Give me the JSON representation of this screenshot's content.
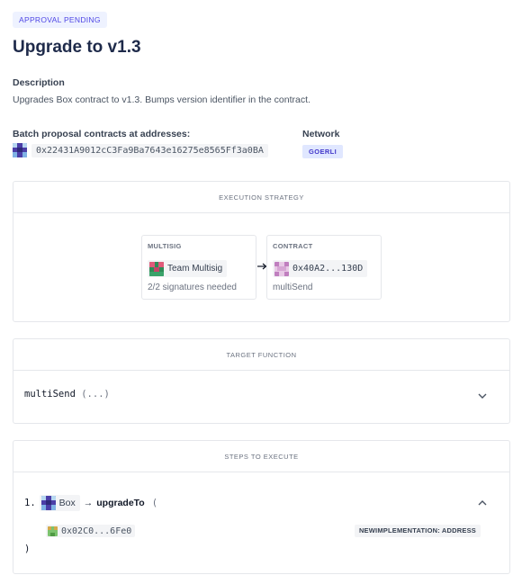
{
  "status": {
    "badge": "APPROVAL PENDING"
  },
  "proposal": {
    "title": "Upgrade to v1.3",
    "description_label": "Description",
    "description": "Upgrades Box contract to v1.3. Bumps version identifier in the contract.",
    "batch_label": "Batch proposal contracts at addresses:",
    "batch_address": "0x22431A9012cC3Fa9Ba7643e16275e8565Ff3a0BA",
    "network_label": "Network",
    "network": "GOERLI"
  },
  "execution_strategy": {
    "header": "EXECUTION STRATEGY",
    "multisig": {
      "title": "MULTISIG",
      "name": "Team Multisig",
      "signatures": "2/2 signatures needed"
    },
    "contract": {
      "title": "CONTRACT",
      "address": "0x40A2...130D",
      "function": "multiSend"
    }
  },
  "target_function": {
    "header": "TARGET FUNCTION",
    "name": "multiSend",
    "args": "(...)"
  },
  "steps": {
    "header": "STEPS TO EXECUTE",
    "items": [
      {
        "index": "1.",
        "contract": "Box",
        "arrow": "→",
        "function": "upgradeTo",
        "open_paren": "(",
        "param_value": "0x02C0...6Fe0",
        "param_type": "NEWIMPLEMENTATION: ADDRESS",
        "close_paren": ")"
      }
    ]
  },
  "icons": {
    "identicon": "blockie-identicon",
    "expand": "chevron-down-icon",
    "collapse": "chevron-up-icon",
    "connector": "arrow-right-icon"
  },
  "colors": {
    "accent": "#4f46e5",
    "badge_bg": "#eef2ff",
    "border": "#e5e7eb",
    "chip_bg": "#f3f4f6"
  }
}
